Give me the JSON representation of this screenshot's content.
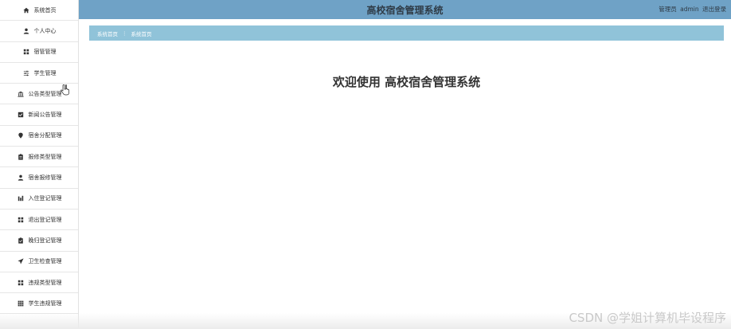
{
  "sidebar": {
    "items": [
      {
        "label": "系统首页",
        "icon": "home-icon"
      },
      {
        "label": "个人中心",
        "icon": "user-icon"
      },
      {
        "label": "宿管管理",
        "icon": "grid-icon"
      },
      {
        "label": "学生管理",
        "icon": "sliders-icon"
      },
      {
        "label": "公告类型管理",
        "icon": "building-icon"
      },
      {
        "label": "新闻公告管理",
        "icon": "check-square-icon"
      },
      {
        "label": "宿舍分配管理",
        "icon": "pin-icon"
      },
      {
        "label": "报修类型管理",
        "icon": "clipboard-icon"
      },
      {
        "label": "宿舍报修管理",
        "icon": "user-icon"
      },
      {
        "label": "入住登记管理",
        "icon": "bar-chart-icon"
      },
      {
        "label": "退出登记管理",
        "icon": "grid-icon"
      },
      {
        "label": "晚归登记管理",
        "icon": "clipboard-check-icon"
      },
      {
        "label": "卫生检查管理",
        "icon": "send-icon"
      },
      {
        "label": "违规类型管理",
        "icon": "grid-icon"
      },
      {
        "label": "学生违规管理",
        "icon": "table-icon"
      }
    ]
  },
  "header": {
    "title": "高校宿舍管理系统",
    "role": "管理员",
    "username": "admin",
    "logout": "退出登录",
    "color": "#6fa2c6"
  },
  "breadcrumb": {
    "root": "系统首页",
    "separator": "⋮",
    "current": "系统首页",
    "color": "#90c3d9"
  },
  "main": {
    "welcome": "欢迎使用 高校宿舍管理系统"
  },
  "watermark": "CSDN @学姐计算机毕设程序"
}
